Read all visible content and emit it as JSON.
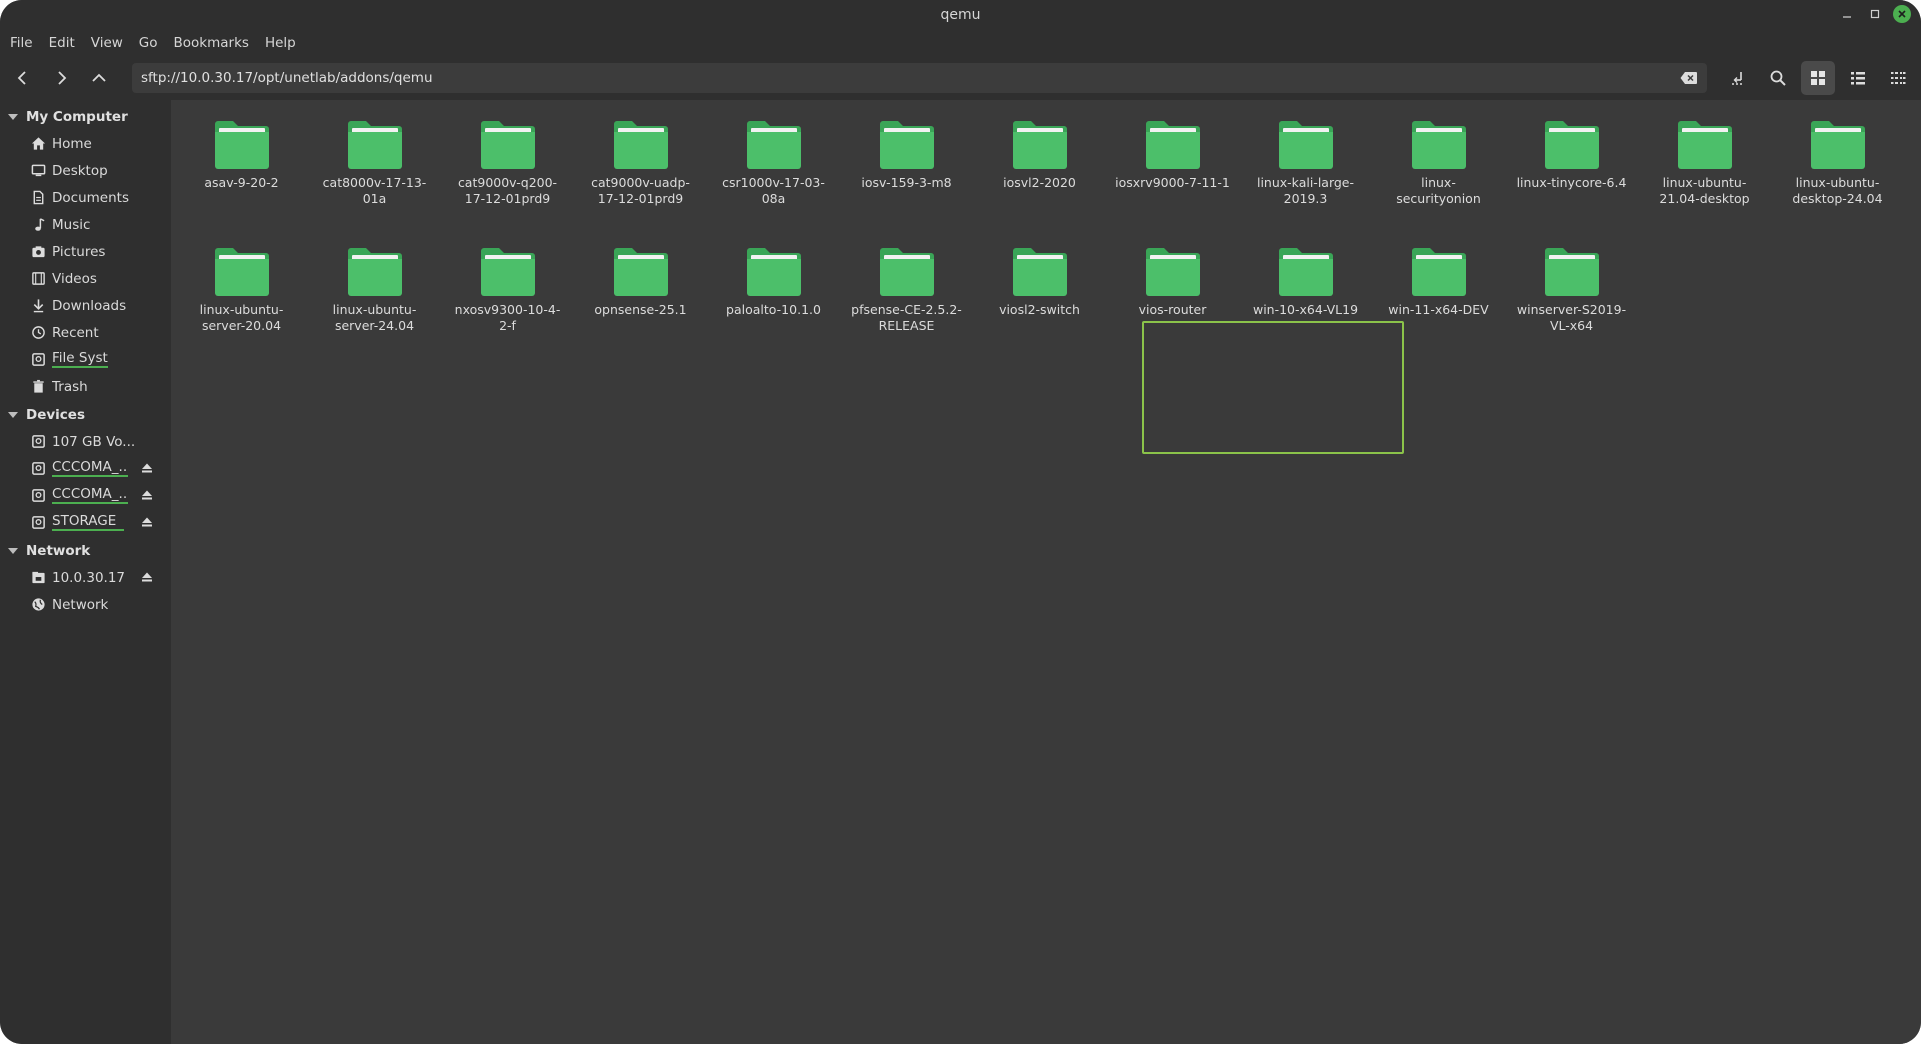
{
  "window": {
    "title": "qemu"
  },
  "menu": [
    "File",
    "Edit",
    "View",
    "Go",
    "Bookmarks",
    "Help"
  ],
  "location": {
    "path": "sftp://10.0.30.17/opt/unetlab/addons/qemu"
  },
  "sidebar": {
    "sections": [
      {
        "title": "My Computer",
        "items": [
          {
            "label": "Home",
            "icon": "home-icon"
          },
          {
            "label": "Desktop",
            "icon": "desktop-icon"
          },
          {
            "label": "Documents",
            "icon": "documents-icon"
          },
          {
            "label": "Music",
            "icon": "music-icon"
          },
          {
            "label": "Pictures",
            "icon": "pictures-icon"
          },
          {
            "label": "Videos",
            "icon": "videos-icon"
          },
          {
            "label": "Downloads",
            "icon": "downloads-icon"
          },
          {
            "label": "Recent",
            "icon": "recent-icon"
          },
          {
            "label": "File System",
            "icon": "drive-icon"
          },
          {
            "label": "Trash",
            "icon": "trash-icon"
          }
        ]
      },
      {
        "title": "Devices",
        "items": [
          {
            "label": "107 GB Vo...",
            "icon": "drive-icon"
          },
          {
            "label": "CCCOMA_...",
            "icon": "disc-icon"
          },
          {
            "label": "CCCOMA_...",
            "icon": "disc-icon"
          },
          {
            "label": "STORAGE",
            "icon": "drive-icon"
          }
        ]
      },
      {
        "title": "Network",
        "items": [
          {
            "label": "10.0.30.17",
            "icon": "network-share-icon"
          },
          {
            "label": "Network",
            "icon": "globe-icon"
          }
        ]
      }
    ]
  },
  "folders": [
    "asav-9-20-2",
    "cat8000v-17-13-01a",
    "cat9000v-q200-17-12-01prd9",
    "cat9000v-uadp-17-12-01prd9",
    "csr1000v-17-03-08a",
    "iosv-159-3-m8",
    "iosvl2-2020",
    "iosxrv9000-7-11-1",
    "linux-kali-large-2019.3",
    "linux-securityonion",
    "linux-tinycore-6.4",
    "linux-ubuntu-21.04-desktop",
    "linux-ubuntu-desktop-24.04",
    "linux-ubuntu-server-20.04",
    "linux-ubuntu-server-24.04",
    "nxosv9300-10-4-2-f",
    "opnsense-25.1",
    "paloalto-10.1.0",
    "pfsense-CE-2.5.2-RELEASE",
    "viosl2-switch",
    "vios-router",
    "win-10-x64-VL19",
    "win-11-x64-DEV",
    "winserver-S2019-VL-x64"
  ],
  "colors": {
    "folder": "#4cbf6a",
    "folder_tab": "#3aa557",
    "accent": "#4caf50",
    "selection": "#8bc34a"
  }
}
